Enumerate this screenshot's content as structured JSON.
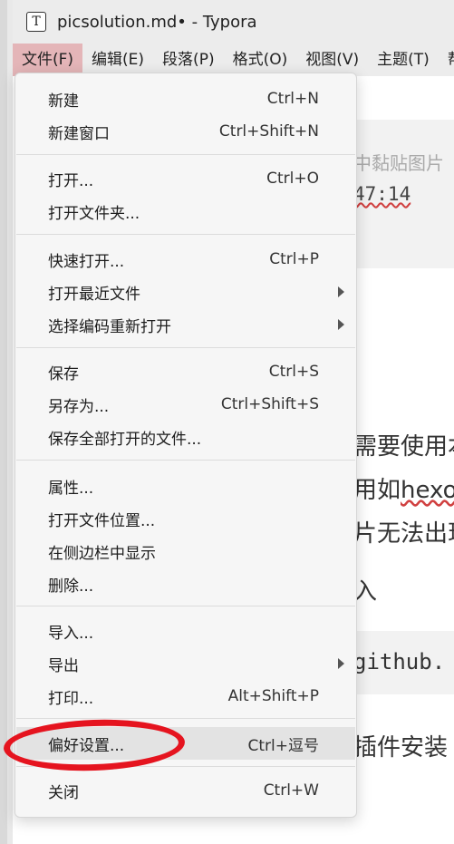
{
  "window": {
    "title": "picsolution.md• - Typora",
    "app_icon_glyph": "T"
  },
  "menubar": {
    "items": [
      {
        "label": "文件(F)",
        "active": true
      },
      {
        "label": "编辑(E)"
      },
      {
        "label": "段落(P)"
      },
      {
        "label": "格式(O)"
      },
      {
        "label": "视图(V)"
      },
      {
        "label": "主题(T)"
      },
      {
        "label": "帮"
      }
    ]
  },
  "editor": {
    "code_gray": "中黏贴图片",
    "code_time": "47:14",
    "para1": "需要使用本",
    "para2_pre": "用如",
    "para2_spell": "hexo",
    "para3": "片无法出现",
    "para4": "入",
    "code2": "github.",
    "para5": "插件安装"
  },
  "file_menu": {
    "items": [
      {
        "label": "新建",
        "shortcut": "Ctrl+N"
      },
      {
        "label": "新建窗口",
        "shortcut": "Ctrl+Shift+N"
      },
      {
        "label": "打开...",
        "shortcut": "Ctrl+O"
      },
      {
        "label": "打开文件夹...",
        "shortcut": ""
      },
      {
        "label": "快速打开...",
        "shortcut": "Ctrl+P"
      },
      {
        "label": "打开最近文件",
        "shortcut": "",
        "submenu": true
      },
      {
        "label": "选择编码重新打开",
        "shortcut": "",
        "submenu": true
      },
      {
        "label": "保存",
        "shortcut": "Ctrl+S"
      },
      {
        "label": "另存为...",
        "shortcut": "Ctrl+Shift+S"
      },
      {
        "label": "保存全部打开的文件...",
        "shortcut": ""
      },
      {
        "label": "属性...",
        "shortcut": ""
      },
      {
        "label": "打开文件位置...",
        "shortcut": ""
      },
      {
        "label": "在侧边栏中显示",
        "shortcut": ""
      },
      {
        "label": "删除...",
        "shortcut": ""
      },
      {
        "label": "导入...",
        "shortcut": ""
      },
      {
        "label": "导出",
        "shortcut": "",
        "submenu": true
      },
      {
        "label": "打印...",
        "shortcut": "Alt+Shift+P"
      },
      {
        "label": "偏好设置...",
        "shortcut": "Ctrl+逗号",
        "highlighted": true
      },
      {
        "label": "关闭",
        "shortcut": "Ctrl+W"
      }
    ]
  },
  "annotation": {
    "color": "#e5141f",
    "shape": "hand-drawn ellipse around preferences item"
  }
}
